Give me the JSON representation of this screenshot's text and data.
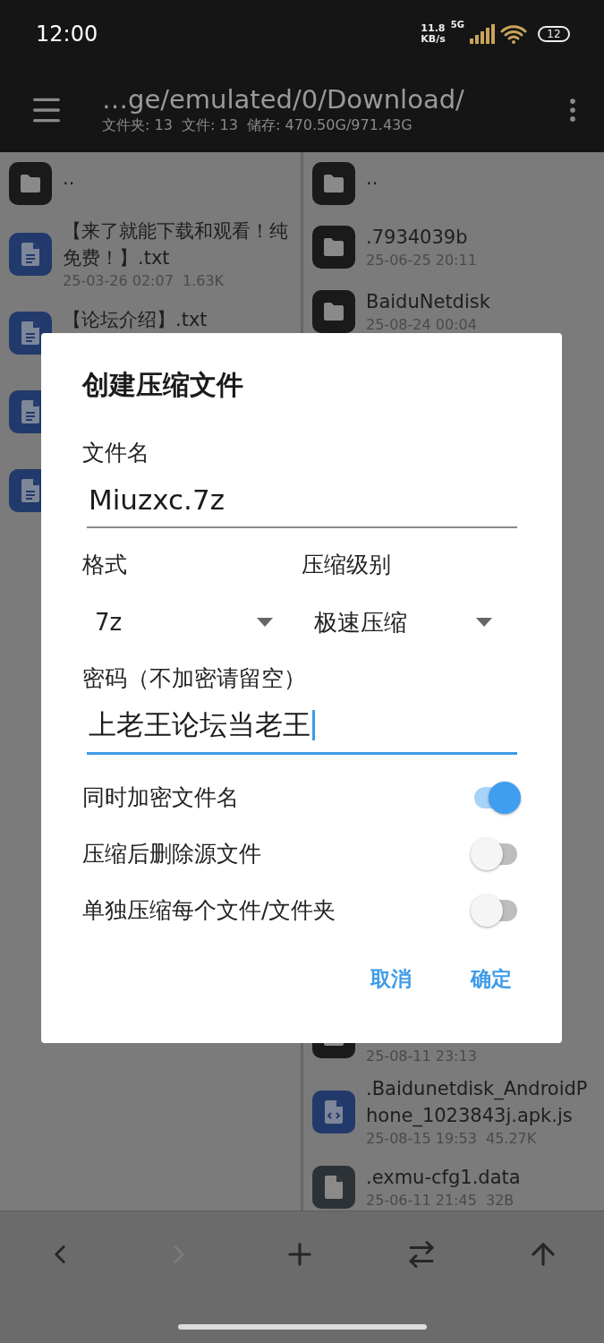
{
  "status_bar": {
    "time": "12:00",
    "net_speed": "11.8",
    "net_unit": "KB/s",
    "network": "5G",
    "battery": "12"
  },
  "toolbar": {
    "path": "…ge/emulated/0/Download/",
    "summary": "文件夹: 13  文件: 13  储存: 470.50G/971.43G"
  },
  "left_pane": {
    "items": [
      {
        "kind": "folder",
        "name": ".."
      },
      {
        "kind": "text",
        "name": "【来了就能下载和观看！纯免费！】.txt",
        "meta": "25-03-26 02:07  1.63K"
      },
      {
        "kind": "text",
        "name": "【论坛介绍】.txt"
      },
      {
        "kind": "text"
      },
      {
        "kind": "text"
      }
    ]
  },
  "right_pane": {
    "items": [
      {
        "kind": "folder",
        "name": ".."
      },
      {
        "kind": "folder",
        "name": ".7934039b",
        "meta": "25-06-25 20:11"
      },
      {
        "kind": "folder",
        "name": "BaiduNetdisk",
        "meta": "25-08-24 00:04"
      }
    ],
    "items_below_dialog": [
      {
        "kind": "folder",
        "meta": "25-08-11 23:13"
      },
      {
        "kind": "code",
        "name": ".Baidunetdisk_AndroidPhone_1023843j.apk.js",
        "meta": "25-08-15 19:53  45.27K"
      },
      {
        "kind": "data",
        "name": ".exmu-cfg1.data",
        "meta": "25-06-11 21:45  32B"
      }
    ]
  },
  "dialog": {
    "title": "创建压缩文件",
    "file_name": {
      "label": "文件名",
      "value": "Miuzxc.7z"
    },
    "format": {
      "label": "格式",
      "value": "7z"
    },
    "level": {
      "label": "压缩级别",
      "value": "极速压缩"
    },
    "password": {
      "label": "密码（不加密请留空）",
      "value": "上老王论坛当老王",
      "focused": true
    },
    "options": [
      {
        "label": "同时加密文件名",
        "on": true
      },
      {
        "label": "压缩后删除源文件",
        "on": false
      },
      {
        "label": "单独压缩每个文件/文件夹",
        "on": false
      }
    ],
    "buttons": [
      "取消",
      "确定"
    ]
  },
  "bottom_bar": [
    {
      "kind": "back",
      "disabled": false
    },
    {
      "kind": "forward",
      "disabled": true
    },
    {
      "kind": "add",
      "disabled": false
    },
    {
      "kind": "swap",
      "disabled": false
    },
    {
      "kind": "up",
      "disabled": false
    }
  ]
}
